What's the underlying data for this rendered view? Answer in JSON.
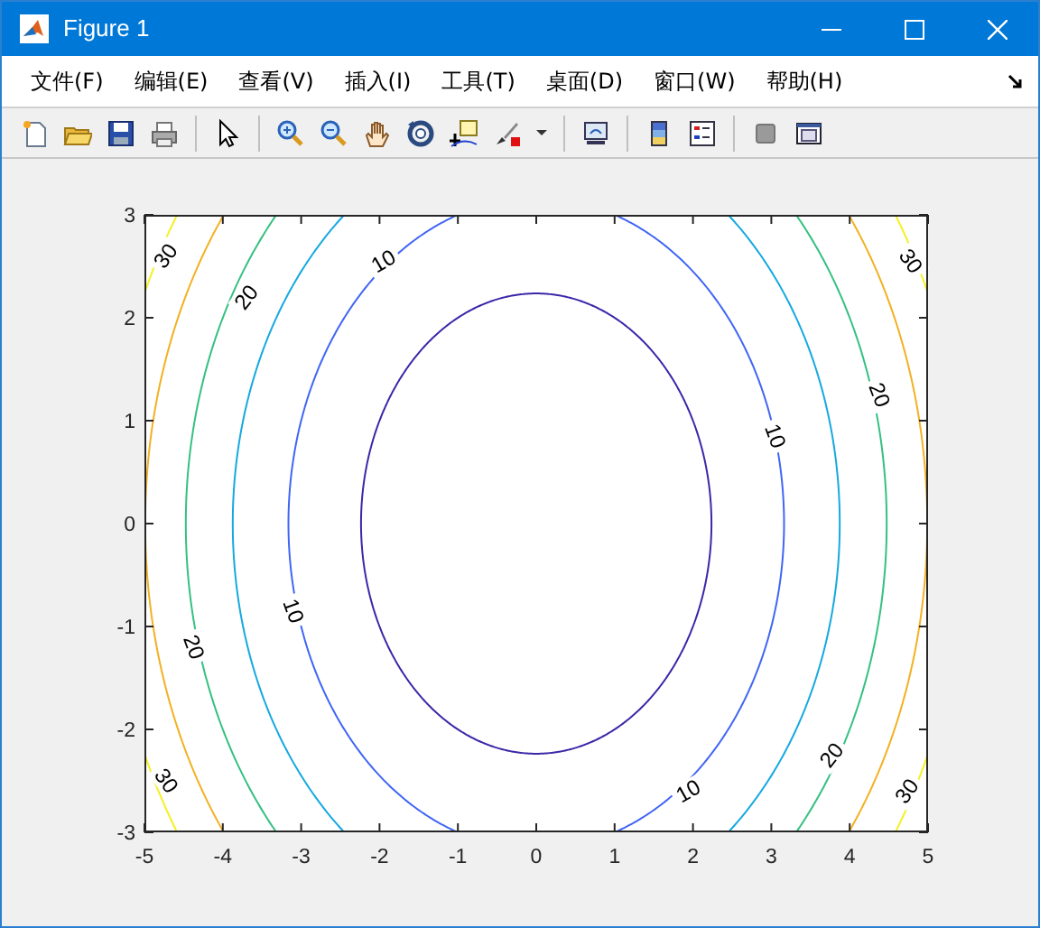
{
  "window": {
    "title": "Figure 1"
  },
  "menus": [
    {
      "label": "文件(F)"
    },
    {
      "label": "编辑(E)"
    },
    {
      "label": "查看(V)"
    },
    {
      "label": "插入(I)"
    },
    {
      "label": "工具(T)"
    },
    {
      "label": "桌面(D)"
    },
    {
      "label": "窗口(W)"
    },
    {
      "label": "帮助(H)"
    }
  ],
  "axes": {
    "xticks": [
      "-5",
      "-4",
      "-3",
      "-2",
      "-1",
      "0",
      "1",
      "2",
      "3",
      "4",
      "5"
    ],
    "yticks": [
      "3",
      "2",
      "1",
      "0",
      "-1",
      "-2",
      "-3"
    ]
  },
  "contours": [
    {
      "color": "#3e26a8"
    },
    {
      "color": "#4166f5"
    },
    {
      "color": "#16a9e0"
    },
    {
      "color": "#35c080"
    },
    {
      "color": "#f2b124"
    },
    {
      "color": "#f5f020"
    }
  ],
  "contour_labels": [
    {
      "text": "30"
    },
    {
      "text": "20"
    },
    {
      "text": "10"
    },
    {
      "text": "10"
    },
    {
      "text": "20"
    },
    {
      "text": "30"
    },
    {
      "text": "10"
    },
    {
      "text": "20"
    },
    {
      "text": "30"
    },
    {
      "text": "10"
    },
    {
      "text": "20"
    },
    {
      "text": "30"
    }
  ]
}
